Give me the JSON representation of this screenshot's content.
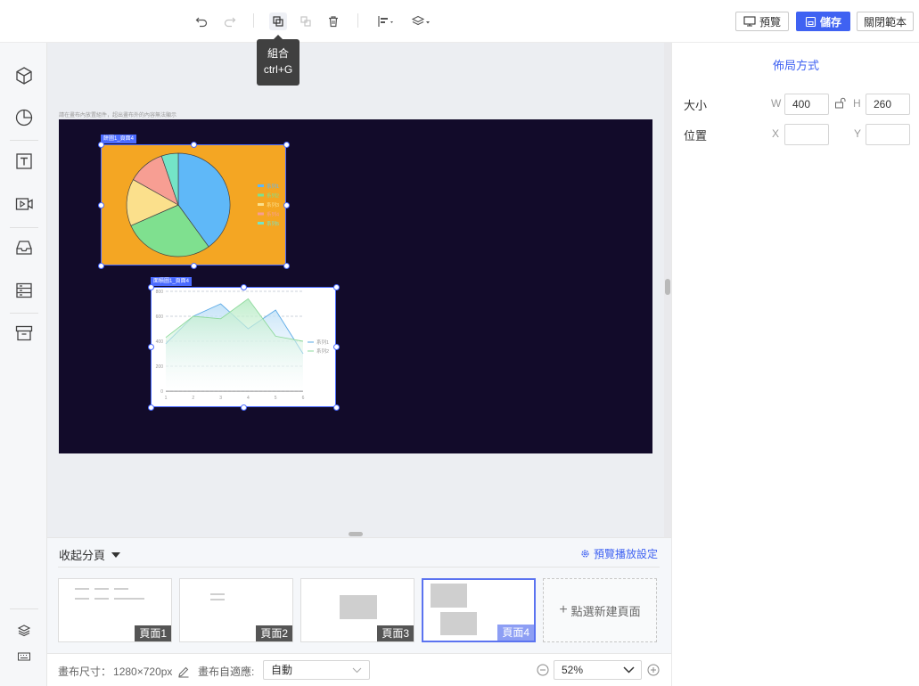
{
  "toolbar": {
    "undo_icon": "undo-icon",
    "redo_icon": "redo-icon",
    "group_icon": "group-icon",
    "ungroup_icon": "ungroup-icon",
    "delete_icon": "trash-icon",
    "align_icon": "align-icon",
    "layer_icon": "layers-icon",
    "preview_label": "預覽",
    "save_label": "儲存",
    "close_template_label": "關閉範本"
  },
  "tooltip": {
    "line1": "組合",
    "line2": "ctrl+G"
  },
  "sidebar": {
    "items": [
      "cube-icon",
      "pie-chart-icon",
      "text-icon",
      "video-icon",
      "inbox-icon",
      "list-icon",
      "archive-icon"
    ],
    "bottom": [
      "layers-icon",
      "keyboard-icon"
    ]
  },
  "canvas": {
    "hint": "請在畫布內放置組件，超出畫布外的內容無法顯示",
    "background": "#120b2a",
    "element1": {
      "tag": "餅圖1_頁面4",
      "bg": "#f4a623",
      "legend": [
        "系列1",
        "系列2",
        "系列3",
        "系列4",
        "系列5"
      ]
    },
    "element2": {
      "tag": "面積圖1_頁面4",
      "legend": [
        "系列1",
        "系列2"
      ]
    }
  },
  "chart_data": [
    {
      "type": "pie",
      "title": "",
      "categories": [
        "",
        "",
        "",
        "",
        ""
      ],
      "values": [
        38,
        27,
        14,
        11,
        5
      ],
      "colors": [
        "#5fb8f8",
        "#7fe08f",
        "#fbe08c",
        "#f79e93",
        "#74e4c7"
      ],
      "legend_position": "right"
    },
    {
      "type": "area",
      "title": "",
      "x": [
        1,
        2,
        3,
        4,
        5,
        6
      ],
      "series": [
        {
          "name": "系列1",
          "values": [
            380,
            600,
            700,
            500,
            650,
            300
          ]
        },
        {
          "name": "系列2",
          "values": [
            430,
            600,
            580,
            740,
            440,
            400
          ]
        }
      ],
      "ylim": [
        0,
        800
      ],
      "yticks": [
        0,
        200,
        400,
        600,
        800
      ],
      "grid": true,
      "legend_position": "right"
    }
  ],
  "right_panel": {
    "title": "佈局方式",
    "size_label": "大小",
    "w_label": "W",
    "w_value": "400",
    "h_label": "H",
    "h_value": "260",
    "position_label": "位置",
    "x_label": "X",
    "x_value": "",
    "y_label": "Y",
    "y_value": ""
  },
  "pages": {
    "collapse_label": "收起分頁",
    "preview_settings_label": "預覽播放設定",
    "items": [
      "頁面1",
      "頁面2",
      "頁面3",
      "頁面4"
    ],
    "active_index": 3,
    "new_page_label": "點選新建頁面"
  },
  "status": {
    "canvas_size_label": "畫布尺寸：",
    "canvas_size_value": "1280×720px",
    "fit_label": "畫布自適應:",
    "fit_value": "自動",
    "zoom_value": "52%"
  }
}
